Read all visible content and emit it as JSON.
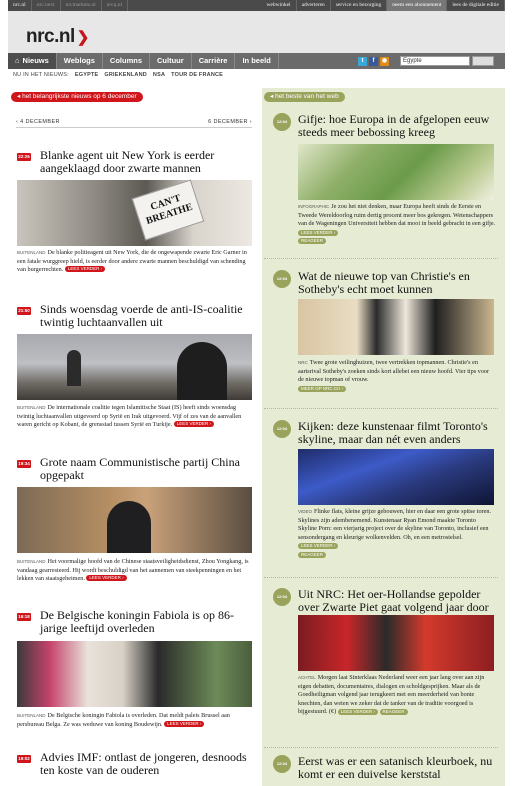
{
  "topbar": {
    "items": [
      "nrc.nl",
      "nrc.next",
      "nrcmarkets.nl",
      "nrcq.nl",
      "webwinkel",
      "adverteren",
      "service en bezorging",
      "neem een abonnement",
      "lees de digitale editie"
    ]
  },
  "logo": {
    "text": "nrc.nl"
  },
  "nav": {
    "items": [
      "Nieuws",
      "Weblogs",
      "Columns",
      "Cultuur",
      "Carrière",
      "In beeld"
    ],
    "search_value": "Egypte"
  },
  "tags": {
    "label": "NU IN HET NIEUWS:",
    "items": [
      "EGYPTE",
      "GRIEKENLAND",
      "NSA",
      "TOUR DE FRANCE"
    ]
  },
  "left": {
    "header": "het belangrijkste nieuws op 6 december",
    "prev_day": "‹ 4 DECEMBER",
    "next_day": "6 DECEMBER ›",
    "articles": [
      {
        "time": "22:26",
        "title": "Blanke agent uit New York is eerder aangeklaagd door zwarte mannen",
        "source": "BUITENLAND",
        "text": "De blanke politieagent uit New York, die de ongewapende zwarte Eric Garner in een fatale wurggreep hield, is eerder door andere zwarte mannen beschuldigd van schending van burgerrechten.",
        "more": "LEES VERDER ›",
        "sign": "CAN'T BREATHE"
      },
      {
        "time": "21:50",
        "title": "Sinds woensdag voerde de anti-IS-coalitie twintig luchtaanvallen uit",
        "source": "BUITENLAND",
        "text": "De internationale coalitie tegen Islamitische Staat (IS) heeft sinds woensdag twintig luchtaanvallen uitgevoerd op Syrië en Irak uitgevoerd. Vijf of zes van de aanvallen waren gericht op Kobani, de grensstad tussen Syrië en Turkije.",
        "more": "LEES VERDER ›"
      },
      {
        "time": "19:34",
        "title": "Grote naam Communistische partij China opgepakt",
        "source": "BUITENLAND",
        "text": "Het voormalige hoofd van de Chinese staatsveiligheidsdienst, Zhou Yongkang, is vandaag gearresteerd. Hij wordt beschuldigd van het aannemen van steekpenningen en het lekken van staatsgeheimen.",
        "more": "LEES VERDER ›"
      },
      {
        "time": "16:18",
        "title": "De Belgische koningin Fabiola is op 86-jarige leeftijd overleden",
        "source": "BUITENLAND",
        "text": "De Belgische koningin Fabiola is overleden. Dat meldt paleis Brussel aan persbureau Belga. Ze was weduwe van koning Boudewijn.",
        "more": "LEES VERDER ›"
      },
      {
        "time": "19:02",
        "title": "Advies IMF: ontlast de jongeren, desnoods ten koste van de ouderen"
      }
    ]
  },
  "right": {
    "header": "het beste van het web",
    "articles": [
      {
        "time": "12:04",
        "title": "Gifje: hoe Europa in de afgelopen eeuw steeds meer bebossing kreeg",
        "source": "INFOGRAPHIC",
        "text": "Je zou het niet denken, maar Europa heeft sinds de Eerste en Tweede Wereldoorlog ruim dertig procent meer bos gekregen. Wetenschappers van de Wageningen Universiteit hebben dat mooi in beeld gebracht in een gifje.",
        "more": "LEES VERDER ›",
        "more2": "REAGEER"
      },
      {
        "time": "12:04",
        "title": "Wat de nieuwe top van Christie's en Sotheby's echt moet kunnen",
        "source": "NRC",
        "text": "Twee grote veilinghuizen, twee vertrekken topmannen. Christie's en aartsrival Sotheby's zoeken sinds kort allebei een nieuw hoofd. Vier tips voor de nieuwe topman of vrouw.",
        "more": "MEER OP NRC.CH ›"
      },
      {
        "time": "12:04",
        "title": "Kijken: deze kunstenaar filmt Toronto's skyline, maar dan nét even anders",
        "source": "VIDEO",
        "text": "Flinke flats, kleine grijze gebouwen, hier en daar een grote spitse toren. Skylines zijn adembenemend. Kunstenaar Ryan Emond maakte Toronto Skyline Porn: een vierjarig project over de skyline van Toronto, inclusief een sensondergang en kleurige wolkenvelden. Oh, en een metrostelsel.",
        "more": "LEES VERDER ›",
        "more2": "REAGEER"
      },
      {
        "time": "12:04",
        "title": "Uit NRC: Het oer-Hollandse gepolder over Zwarte Piet gaat volgend jaar door",
        "source": "ACHTEL",
        "text": "Morgen laat Sinterklaas Nederland weer een jaar lang over aan zijn eigen debatten, documentaires, dialogen en scholdgesprijken. Maar als de Goedheiligman volgend jaar terugkeert met een meerderheid van bonte knechten, dan weten we zeker dat de tanker van de traditie voorgoed is bijgestuurd. (€)",
        "more": "LEES VERDER ›",
        "more2": "REAGEER"
      },
      {
        "time": "12:04",
        "title": "Eerst was er een satanisch kleurboek, nu komt er een duivelse kerststal"
      }
    ]
  },
  "colors": {
    "red": "#d0151b",
    "olive": "#9aa35c",
    "olive_bg": "#e6ebd3",
    "nav": "#6b6b6b"
  }
}
